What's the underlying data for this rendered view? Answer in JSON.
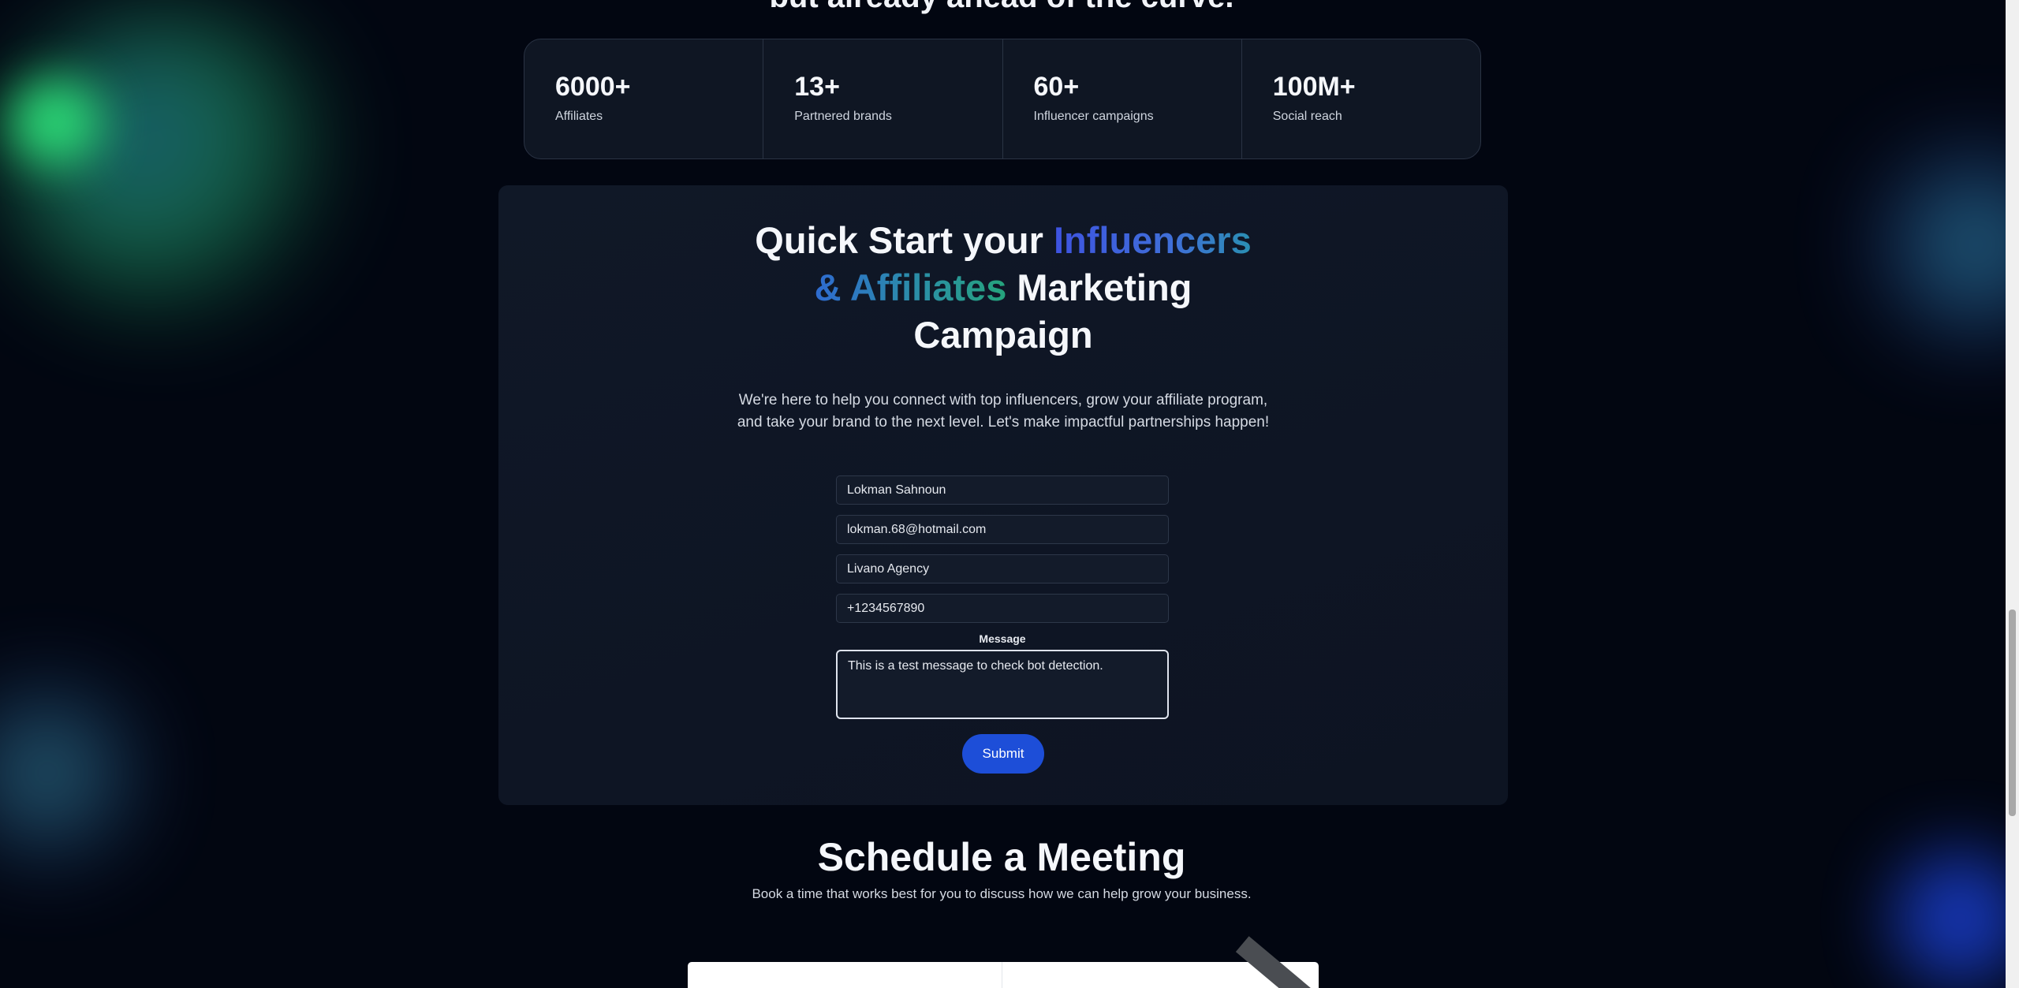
{
  "top_heading": "but already ahead of the curve.",
  "stats": [
    {
      "value": "6000+",
      "label": "Affiliates"
    },
    {
      "value": "13+",
      "label": "Partnered brands"
    },
    {
      "value": "60+",
      "label": "Influencer campaigns"
    },
    {
      "value": "100M+",
      "label": "Social reach"
    }
  ],
  "campaign": {
    "title_part1": "Quick Start your ",
    "title_highlight1": "Influencers",
    "title_highlight2": "& Affiliates",
    "title_part2": " Marketing",
    "title_part3": "Campaign",
    "description": "We're here to help you connect with top influencers, grow your affiliate program, and take your brand to the next level. Let's make impactful partnerships happen!",
    "form": {
      "name_value": "Lokman Sahnoun",
      "email_value": "lokman.68@hotmail.com",
      "company_value": "Livano Agency",
      "phone_value": "+1234567890",
      "message_label": "Message",
      "message_value": "This is a test message to check bot detection.",
      "submit_label": "Submit"
    }
  },
  "schedule": {
    "title": "Schedule a Meeting",
    "subtitle": "Book a time that works best for you to discuss how we can help grow your business."
  },
  "colors": {
    "background": "#020611",
    "card": "#0f1623",
    "accent_blue": "#1d4ed8",
    "highlight_blue": "#3e53e0",
    "highlight_teal": "#25a47c"
  }
}
